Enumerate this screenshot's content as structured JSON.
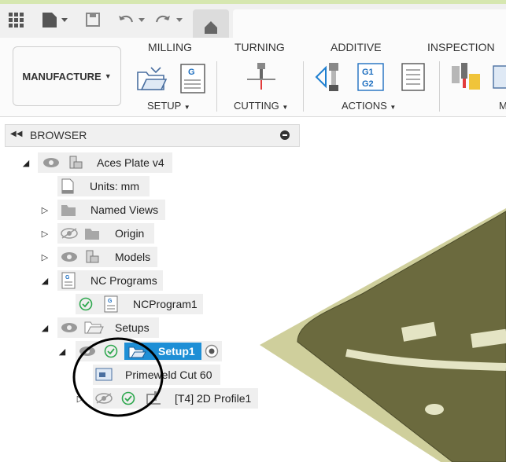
{
  "toolbar": {
    "workspace_label": "MANUFACTURE",
    "tabs": [
      "MILLING",
      "TURNING",
      "ADDITIVE",
      "INSPECTION"
    ],
    "panels": [
      "SETUP",
      "CUTTING",
      "ACTIONS",
      "M"
    ],
    "icons": [
      "grid-icon",
      "file-icon",
      "save-icon",
      "undo-icon",
      "redo-icon",
      "home-icon"
    ],
    "g_icon_text": "G",
    "g1_text": "G1",
    "g2_text": "G2"
  },
  "browser": {
    "title": "BROWSER",
    "items": [
      {
        "label": "Aces Plate v4"
      },
      {
        "label": "Units: mm"
      },
      {
        "label": "Named Views"
      },
      {
        "label": "Origin"
      },
      {
        "label": "Models"
      },
      {
        "label": "NC Programs"
      },
      {
        "label": "NCProgram1"
      },
      {
        "label": "Setups"
      },
      {
        "label": "Setup1"
      },
      {
        "label": "Primeweld Cut 60"
      },
      {
        "label": "[T4] 2D Profile1"
      }
    ]
  },
  "colors": {
    "accent": "#1e8fd6",
    "check": "#2fa84f",
    "model": "#6d6b3f"
  }
}
